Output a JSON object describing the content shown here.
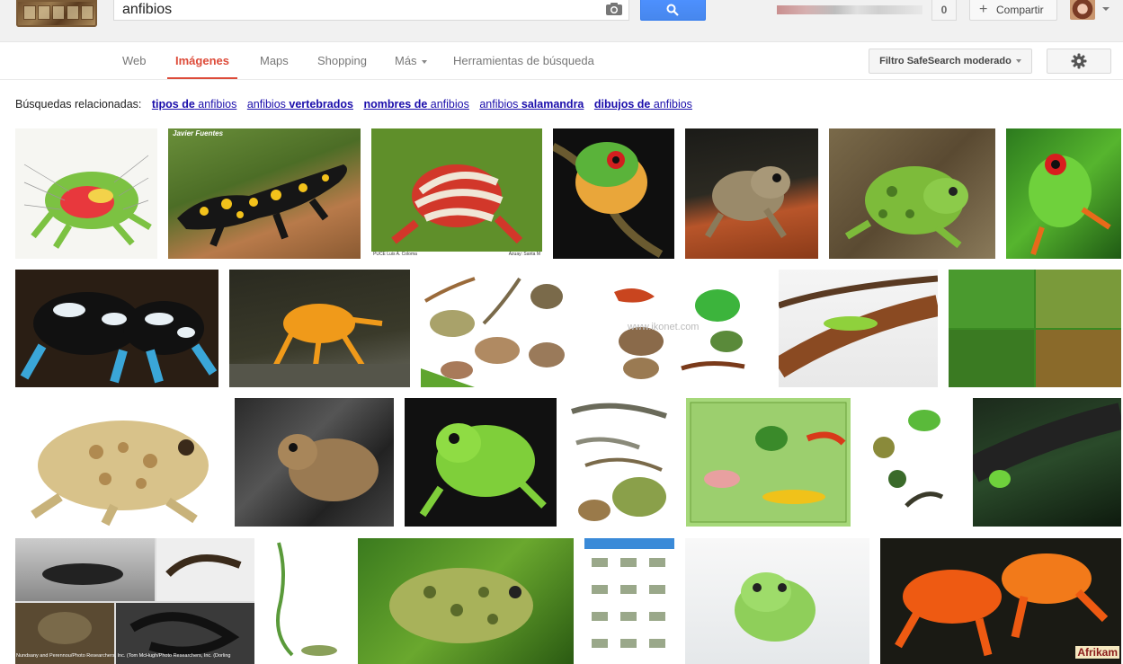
{
  "search": {
    "query": "anfibios"
  },
  "header": {
    "notifications": "0",
    "share_label": "Compartir",
    "plus": "+"
  },
  "nav": {
    "tabs": [
      {
        "label": "Web"
      },
      {
        "label": "Imágenes"
      },
      {
        "label": "Maps"
      },
      {
        "label": "Shopping"
      },
      {
        "label": "Más"
      },
      {
        "label": "Herramientas de búsqueda"
      }
    ],
    "safesearch_label": "Filtro SafeSearch moderado"
  },
  "related": {
    "prefix": "Búsquedas relacionadas:",
    "items": [
      {
        "bold": "tipos de",
        "plain": " anfibios"
      },
      {
        "plain": "anfibios ",
        "bold": "vertebrados"
      },
      {
        "bold": "nombres de",
        "plain": " anfibios"
      },
      {
        "plain": "anfibios ",
        "bold": "salamandra"
      },
      {
        "bold": "dibujos de",
        "plain": " anfibios"
      }
    ]
  },
  "colors": {
    "accent": "#dd4b39",
    "link": "#1a0dab",
    "search_blue": "#4d90fe"
  },
  "images": {
    "r1c2_caption": "Javier Fuentes",
    "r1c3_caption_left": "PUCE Luis A. Coloma",
    "r1c3_caption_right": "Azuay: Santa M",
    "r2c4_watermark": "www.ikonet.com",
    "r4c1_credit": "Nundsany and Perennou/Photo Researchers, Inc. (Tom McHugh/Photo Researchers, Inc. (Dorling",
    "r4c7_watermark": "Afrikam"
  }
}
